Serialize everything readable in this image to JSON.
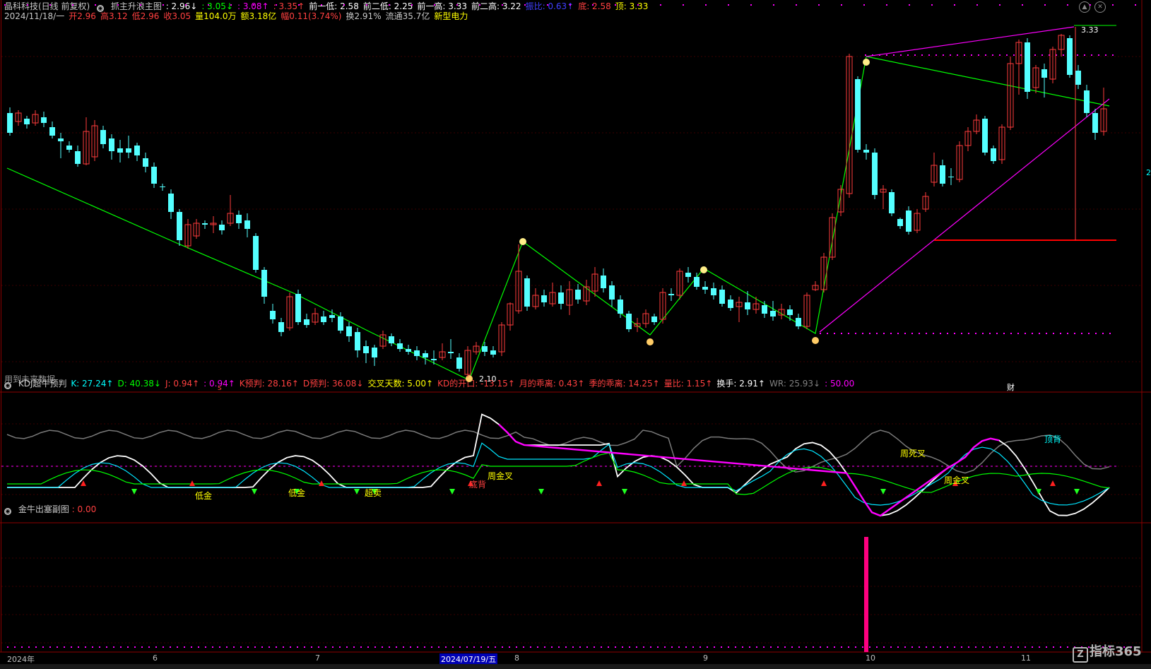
{
  "main": {
    "stock": "晶科科技(日线 前复权)",
    "indicator_name": "抓主升浪主图",
    "indicator_values": [
      {
        "text": ": 2.96↓",
        "color": "#ffffff"
      },
      {
        "text": ": 3.05↓",
        "color": "#00ff00"
      },
      {
        "text": ": 3.08↑",
        "color": "#ff00ff"
      },
      {
        "text": ": 3.35↑",
        "color": "#ff4040"
      },
      {
        "text": "前一低: 2.58",
        "color": "#ffffff"
      },
      {
        "text": "前二低: 2.25",
        "color": "#ffffff"
      },
      {
        "text": "前一高: 3.33",
        "color": "#ffffff"
      },
      {
        "text": "前二高: 3.22",
        "color": "#ffffff"
      },
      {
        "text": "振比: 0.63↑",
        "color": "#4040ff"
      },
      {
        "text": "底: 2.58",
        "color": "#ff4040"
      },
      {
        "text": "顶: 3.33",
        "color": "#ffff00"
      }
    ],
    "quote_line": [
      {
        "text": "2024/11/18/一",
        "color": "#c8c8c8"
      },
      {
        "text": "开2.96",
        "color": "#ff4040"
      },
      {
        "text": "高3.12",
        "color": "#ff4040"
      },
      {
        "text": "低2.96",
        "color": "#ff4040"
      },
      {
        "text": "收3.05",
        "color": "#ff4040"
      },
      {
        "text": "量104.0万",
        "color": "#ffff00"
      },
      {
        "text": "额3.18亿",
        "color": "#ffff00"
      },
      {
        "text": "幅0.11(3.74%)",
        "color": "#ff4040"
      },
      {
        "text": "换2.91%",
        "color": "#c8c8c8"
      },
      {
        "text": "流通35.7亿",
        "color": "#c8c8c8"
      },
      {
        "text": "新型电力",
        "color": "#ffff00"
      }
    ],
    "future_data_label": "用到未来数据",
    "low_label": "2.10",
    "high_label": "3.33",
    "marker_s": "s",
    "marker_cai": "财",
    "right_label": "2"
  },
  "kdj": {
    "title": "KDJ超牛预判",
    "values": [
      {
        "text": "K: 27.24↑",
        "color": "#00ffff"
      },
      {
        "text": "D: 40.38↓",
        "color": "#00ff00"
      },
      {
        "text": "J: 0.94↑",
        "color": "#ff4040"
      },
      {
        "text": ": 0.94↑",
        "color": "#ff00ff"
      },
      {
        "text": "K预判: 28.16↑",
        "color": "#ff4040"
      },
      {
        "text": "D预判: 36.08↓",
        "color": "#ff4040"
      },
      {
        "text": "交叉天数: 5.00↑",
        "color": "#ffff00"
      },
      {
        "text": "KD的开口: -13.15↑",
        "color": "#ff4040"
      },
      {
        "text": "月的乖离: 0.43↑",
        "color": "#ff4040"
      },
      {
        "text": "季的乖离: 14.25↑",
        "color": "#ff4040"
      },
      {
        "text": "量比: 1.15↑",
        "color": "#ff4040"
      },
      {
        "text": "换手: 2.91↑",
        "color": "#ffffff"
      },
      {
        "text": "WR: 25.93↓",
        "color": "#808080"
      },
      {
        "text": ": 50.00",
        "color": "#ff00ff"
      }
    ],
    "labels": [
      {
        "text": "低金",
        "color": "#ffff00"
      },
      {
        "text": "低金",
        "color": "#ffff00"
      },
      {
        "text": "超卖",
        "color": "#ffff00"
      },
      {
        "text": "底背",
        "color": "#ff4040"
      },
      {
        "text": "周金叉",
        "color": "#ffff00"
      },
      {
        "text": "周死叉",
        "color": "#ffff00"
      },
      {
        "text": "周金叉",
        "color": "#ffff00"
      },
      {
        "text": "顶背",
        "color": "#00ffff"
      }
    ]
  },
  "sub": {
    "title": "金牛出塞副图",
    "value": ": 0.00"
  },
  "axis": {
    "dates": [
      "2024年",
      "6",
      "7",
      "2024/07/19/五",
      "8",
      "9",
      "10",
      "11"
    ]
  },
  "brand": {
    "logo": "Z",
    "text": "指标365"
  },
  "colors": {
    "up": "#ff3c3c",
    "down": "#54ffff",
    "green": "#00ff00",
    "magenta": "#ff00ff",
    "grid": "#3a0000",
    "border": "#8b0000"
  }
}
